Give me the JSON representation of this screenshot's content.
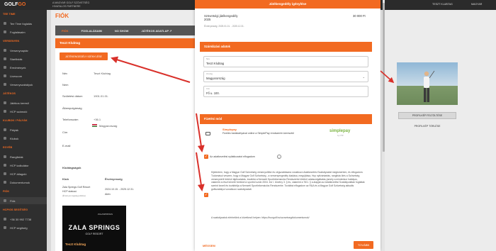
{
  "topbar": {
    "logo_prefix": "GOLF",
    "logo_suffix": "GO",
    "subtitle_line1": "A MAGYAR GOLF SZÖVETSÉG",
    "subtitle_line2": "HIVATALOS PARTNERE",
    "user": "TESZT KLUBTAG",
    "language": "MAGYAR"
  },
  "sidebar": {
    "sections": [
      {
        "title": "TEE TIME"
      },
      {
        "title": "VERSENYEK"
      },
      {
        "title": "JÁTÉKOS"
      },
      {
        "title": "KLUBOK / PÁLYÁK"
      },
      {
        "title": "EGYÉB"
      },
      {
        "title": "FIÓK"
      },
      {
        "title": "HCP/GS SEGÍTSÉG"
      }
    ],
    "items": [
      {
        "label": "Tee Time foglalás"
      },
      {
        "label": "Foglalásaim"
      },
      {
        "label": "Versenynaptár"
      },
      {
        "label": "Startlisták"
      },
      {
        "label": "Eredmények"
      },
      {
        "label": "Livescore"
      },
      {
        "label": "Versenyszabályok"
      },
      {
        "label": "Játékos kereső"
      },
      {
        "label": "HCP számoló"
      },
      {
        "label": "Pályák"
      },
      {
        "label": "Klubok"
      },
      {
        "label": "Ranglisták"
      },
      {
        "label": "HCP kalkulátor"
      },
      {
        "label": "HCP átlagoló"
      },
      {
        "label": "Dokumentumok"
      },
      {
        "label": "Fiók"
      },
      {
        "label": "+36 30 992 7738"
      },
      {
        "label": "HCP segítség"
      }
    ]
  },
  "page": {
    "title": "FIÓK",
    "tabs": [
      {
        "label": "FIÓK"
      },
      {
        "label": "FOGLALÁSAIM"
      },
      {
        "label": "NO SHOW"
      },
      {
        "label": "JÁTÉKOS ADATLAP ↗"
      }
    ],
    "card_header": "Teszt Klubtag",
    "request_button": "JÁTÉKENGEDÉLY IGÉNYLÉSE",
    "rows": [
      {
        "label": "Név",
        "value": "Teszt Klubtag"
      },
      {
        "label": "Nem",
        "value": ""
      },
      {
        "label": "Születési dátum",
        "value": "1901.01.01."
      },
      {
        "label": "Állampolgárság",
        "value": ""
      },
      {
        "label": "Telefonszám",
        "value": "+36.1"
      },
      {
        "label": "Cím",
        "value": "Magyarország"
      },
      {
        "label": "E-mail",
        "value": ""
      }
    ],
    "memberships_title": "Klubtagságok",
    "memberships_col_club": "Klub",
    "memberships_col_validity": "Érvényesség",
    "membership_club": "Zala Springs Golf Resort",
    "membership_type": "HCP statusú",
    "membership_note": "(Érvényes tagság jelölése)",
    "membership_dates": "2024.10.15. - 2025.12.31.",
    "membership_status": "Aktív",
    "club_logo_top": "ZALASPRINGS",
    "club_logo_big": "ZALA SPRINGS",
    "club_logo_sub": "GOLF RESORT",
    "club_member": "Teszt Klubtag",
    "upload_button": "PROFILKÉP FELTÖLTÉSE",
    "delete_button": "PROFILKÉP TÖRLÉSE"
  },
  "modal": {
    "title": "Játékengedély igénylése",
    "product_line1": "Szövetségi játékengedély",
    "product_line2": "2025",
    "price": "30 000 Ft",
    "validity": "Érvényesség: 2025.01.01. - 2025.12.31.",
    "billing_section": "Számlázási adatok",
    "fields": {
      "name_label": "Név",
      "name_value": "Teszt Klubtag",
      "country_label": "Ország",
      "country_value": "Magyarország",
      "address_label": "Cím",
      "address_value": "Fő u. 100."
    },
    "payment_section": "Fizetési mód",
    "payment_name": "Simplepay",
    "payment_desc": "Fizetés bankkártyával online a SimplePay rendszerén keresztül",
    "simplepay_logo": "simplepay",
    "simplepay_sub": "by OTP",
    "consent1": "Az adatkezelési nyilatkozatot elfogadom",
    "consent2_text": "Kijelentem, hogy a Magyar Golf Szövetség versenyzőlike és cégszabtására vonatkozó Adatkezelési Szabályzatát megismertem, és elfogadom. Tudomásul veszem, hogy a Magyar Golf Szövetség - a versenyengedély kiadása, megújítása, Hcp nyilvántartás, ranglista ölés a Szövetség versenyeiről történő tájékoztatás, továbbá a Nemzeti Sportinformációs Rendszerbe történő adatszolgáltatás (amely a mindenkor hatályos, valamint a részt követő hírekkel a sportról szóló 2004. évi I. törvény 3. § és, valamint a 76/1. § a alapján az Adatkezelési Szabályzatban foglaltak szerint kezeli és továbbítja a Nemzeti Sportinformációs Rendszerbe.",
    "consent2_extra": "Továbbá elfogadom az R&A és a Magyar Golf Szövetség aktuális golfszabályoi vonatkozó szabályzatait.",
    "footer_text": "A szabályzatok elérhetőek a következő helyen: https://hungolf.hu/szovetseg/dokumentumok/",
    "cancel": "MÉGSEM",
    "next": "TOVÁBB"
  },
  "colors": {
    "accent": "#f26a21",
    "sidebar": "#2f2f2f",
    "arrow": "#d9302a"
  }
}
